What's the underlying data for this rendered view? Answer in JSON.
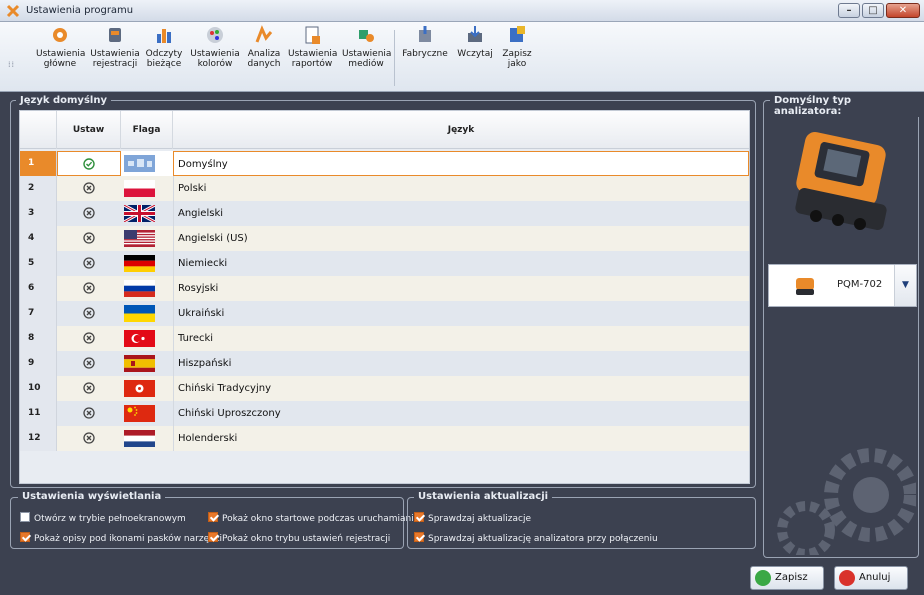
{
  "window": {
    "title": "Ustawienia programu"
  },
  "toolbar": {
    "items": [
      {
        "l1": "Ustawienia",
        "l2": "główne",
        "icon": "gear-icon"
      },
      {
        "l1": "Ustawienia",
        "l2": "rejestracji",
        "icon": "recording-icon"
      },
      {
        "l1": "Odczyty",
        "l2": "bieżące",
        "icon": "bar-chart-icon"
      },
      {
        "l1": "Ustawienia",
        "l2": "kolorów",
        "icon": "palette-icon"
      },
      {
        "l1": "Analiza",
        "l2": "danych",
        "icon": "analysis-icon"
      },
      {
        "l1": "Ustawienia",
        "l2": "raportów",
        "icon": "report-icon"
      },
      {
        "l1": "Ustawienia",
        "l2": "mediów",
        "icon": "media-icon"
      },
      {
        "l1": "Fabryczne",
        "l2": "",
        "icon": "factory-reset-icon"
      },
      {
        "l1": "Wczytaj",
        "l2": "",
        "icon": "load-icon"
      },
      {
        "l1": "Zapisz",
        "l2": "jako",
        "icon": "save-as-icon"
      }
    ]
  },
  "language_panel": {
    "label": "Język domyślny",
    "headers": {
      "set": "Ustaw",
      "flag": "Flaga",
      "language": "Język"
    },
    "rows": [
      {
        "num": "1",
        "active": true,
        "language": "Domyślny",
        "flag": "default"
      },
      {
        "num": "2",
        "active": false,
        "language": "Polski",
        "flag": "pl"
      },
      {
        "num": "3",
        "active": false,
        "language": "Angielski",
        "flag": "gb"
      },
      {
        "num": "4",
        "active": false,
        "language": "Angielski (US)",
        "flag": "us"
      },
      {
        "num": "5",
        "active": false,
        "language": "Niemiecki",
        "flag": "de"
      },
      {
        "num": "6",
        "active": false,
        "language": "Rosyjski",
        "flag": "ru"
      },
      {
        "num": "7",
        "active": false,
        "language": "Ukraiński",
        "flag": "ua"
      },
      {
        "num": "8",
        "active": false,
        "language": "Turecki",
        "flag": "tr"
      },
      {
        "num": "9",
        "active": false,
        "language": "Hiszpański",
        "flag": "es"
      },
      {
        "num": "10",
        "active": false,
        "language": "Chiński Tradycyjny",
        "flag": "hk"
      },
      {
        "num": "11",
        "active": false,
        "language": "Chiński Uproszczony",
        "flag": "cn"
      },
      {
        "num": "12",
        "active": false,
        "language": "Holenderski",
        "flag": "nl"
      }
    ]
  },
  "analyzer_panel": {
    "label": "Domyślny typ analizatora:",
    "selected": "PQM-702"
  },
  "display_settings": {
    "label": "Ustawienia wyświetlania",
    "options": [
      {
        "text": "Otwórz w trybie pełnoekranowym",
        "checked": false
      },
      {
        "text": "Pokaż opisy pod ikonami pasków narzędzi",
        "checked": true
      },
      {
        "text": "Pokaż okno startowe podczas uruchamiania",
        "checked": true
      },
      {
        "text": "Pokaż okno trybu ustawień rejestracji",
        "checked": true
      }
    ]
  },
  "update_settings": {
    "label": "Ustawienia aktualizacji",
    "options": [
      {
        "text": "Sprawdzaj aktualizacje",
        "checked": true
      },
      {
        "text": "Sprawdzaj aktualizację analizatora przy połączeniu",
        "checked": true
      }
    ]
  },
  "buttons": {
    "save": "Zapisz",
    "cancel": "Anuluj"
  },
  "colors": {
    "accent": "#e98a2a",
    "background": "#3c4150"
  }
}
